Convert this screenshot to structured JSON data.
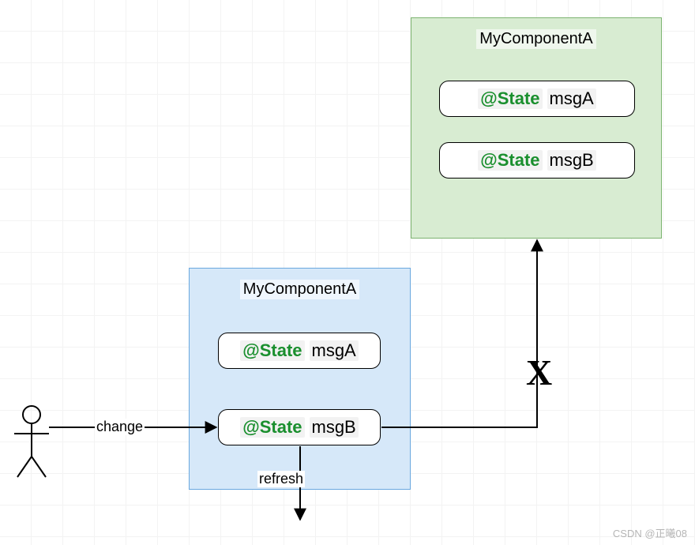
{
  "leftComponent": {
    "title": "MyComponentA",
    "state1": {
      "anno": "@State",
      "var": "msgA"
    },
    "state2": {
      "anno": "@State",
      "var": "msgB"
    }
  },
  "rightComponent": {
    "title": "MyComponentA",
    "state1": {
      "anno": "@State",
      "var": "msgA"
    },
    "state2": {
      "anno": "@State",
      "var": "msgB"
    }
  },
  "edges": {
    "change": "change",
    "refresh": "refresh",
    "blockMark": "X"
  },
  "watermark": "CSDN @正曦08"
}
